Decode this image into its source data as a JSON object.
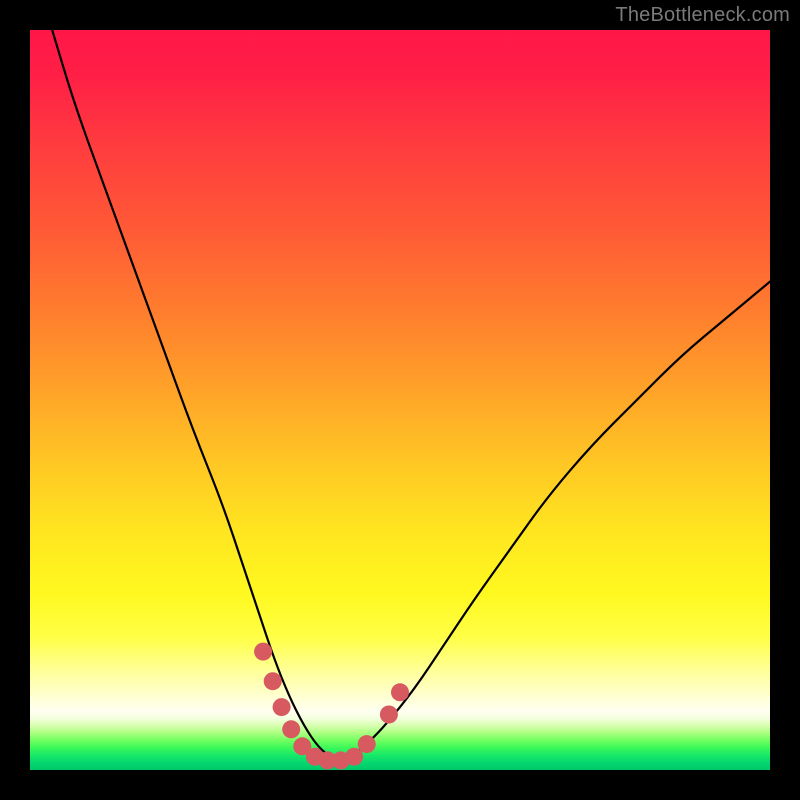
{
  "watermark": "TheBottleneck.com",
  "chart_data": {
    "type": "line",
    "title": "",
    "xlabel": "",
    "ylabel": "",
    "xlim": [
      0,
      100
    ],
    "ylim": [
      0,
      100
    ],
    "series": [
      {
        "name": "bottleneck-curve",
        "x": [
          3,
          6,
          10,
          14,
          18,
          22,
          26,
          29,
          31,
          33,
          35,
          37,
          39,
          41,
          43,
          45,
          48,
          52,
          56,
          60,
          65,
          70,
          76,
          82,
          88,
          94,
          100
        ],
        "y": [
          100,
          90,
          79,
          68,
          57,
          46,
          36,
          27,
          21,
          15,
          10,
          6,
          3,
          1.5,
          1.5,
          3,
          6,
          11,
          17,
          23,
          30,
          37,
          44,
          50,
          56,
          61,
          66
        ]
      }
    ],
    "markers": {
      "name": "highlight-dots",
      "color": "#d65a5f",
      "points": [
        {
          "x": 31.5,
          "y": 16
        },
        {
          "x": 32.8,
          "y": 12
        },
        {
          "x": 34.0,
          "y": 8.5
        },
        {
          "x": 35.3,
          "y": 5.5
        },
        {
          "x": 36.8,
          "y": 3.2
        },
        {
          "x": 38.5,
          "y": 1.8
        },
        {
          "x": 40.2,
          "y": 1.3
        },
        {
          "x": 42.0,
          "y": 1.3
        },
        {
          "x": 43.8,
          "y": 1.8
        },
        {
          "x": 45.5,
          "y": 3.5
        },
        {
          "x": 48.5,
          "y": 7.5
        },
        {
          "x": 50.0,
          "y": 10.5
        }
      ]
    },
    "background": {
      "type": "vertical-gradient",
      "stops": [
        {
          "pos": 0.0,
          "color": "#ff1648"
        },
        {
          "pos": 0.5,
          "color": "#ffb526"
        },
        {
          "pos": 0.8,
          "color": "#ffff50"
        },
        {
          "pos": 0.92,
          "color": "#fffff0"
        },
        {
          "pos": 1.0,
          "color": "#00c86a"
        }
      ]
    }
  }
}
